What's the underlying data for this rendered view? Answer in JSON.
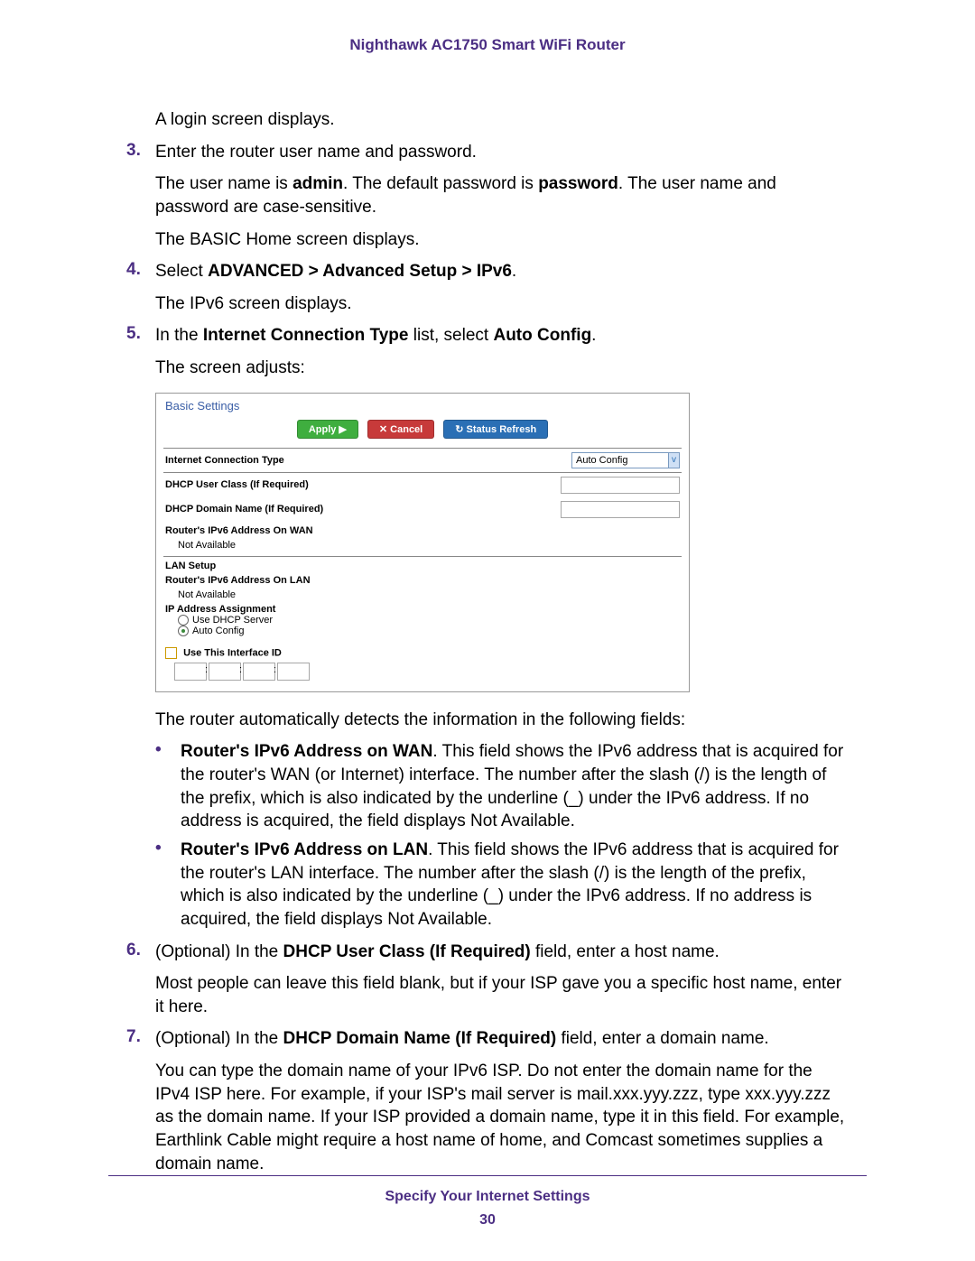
{
  "header": {
    "title": "Nighthawk AC1750 Smart WiFi Router"
  },
  "intro": [
    "A login screen displays."
  ],
  "steps": {
    "s3": {
      "num": "3.",
      "text": "Enter the router user name and password.",
      "after": [
        "The user name is admin. The default password is password. The user name and password are case-sensitive.",
        "The BASIC Home screen displays."
      ],
      "bold": {
        "admin": "admin",
        "password": "password"
      }
    },
    "s4": {
      "num": "4.",
      "text_prefix": "Select ",
      "text_bold": "ADVANCED > Advanced Setup > IPv6",
      "text_suffix": ".",
      "after": [
        "The IPv6 screen displays."
      ]
    },
    "s5": {
      "num": "5.",
      "text_prefix": "In the ",
      "bold1": "Internet Connection Type",
      "mid": " list, select ",
      "bold2": "Auto Config",
      "suffix": ".",
      "after_caption": "The screen adjusts:",
      "after_figure": "The router automatically detects the information in the following fields:",
      "bullets": [
        {
          "bold": "Router's IPv6 Address on WAN",
          "text": ". This field shows the IPv6 address that is acquired for the router's WAN (or Internet) interface. The number after the slash (/) is the length of the prefix, which is also indicated by the underline (_) under the IPv6 address. If no address is acquired, the field displays Not Available."
        },
        {
          "bold": "Router's IPv6 Address on LAN",
          "text": ". This field shows the IPv6 address that is acquired for the router's LAN interface. The number after the slash (/) is the length of the prefix, which is also indicated by the underline (_) under the IPv6 address. If no address is acquired, the field displays Not Available."
        }
      ]
    },
    "s6": {
      "num": "6.",
      "prefix": "(Optional) In the ",
      "bold": "DHCP User Class (If Required)",
      "suffix": " field, enter a host name.",
      "after": [
        "Most people can leave this field blank, but if your ISP gave you a specific host name, enter it here."
      ]
    },
    "s7": {
      "num": "7.",
      "prefix": "(Optional) In the ",
      "bold": "DHCP Domain Name (If Required)",
      "suffix": " field, enter a domain name.",
      "after": [
        "You can type the domain name of your IPv6 ISP. Do not enter the domain name for the IPv4 ISP here. For example, if your ISP's mail server is mail.xxx.yyy.zzz, type xxx.yyy.zzz as the domain name. If your ISP provided a domain name, type it in this field. For example, Earthlink Cable might require a host name of home, and Comcast sometimes supplies a domain name."
      ]
    }
  },
  "figure": {
    "title": "Basic Settings",
    "buttons": {
      "apply": "Apply ▶",
      "cancel": "✕ Cancel",
      "refresh": "↻ Status Refresh"
    },
    "ict_label": "Internet Connection Type",
    "ict_value": "Auto Config",
    "dhcp_user_class": "DHCP User Class  (If Required)",
    "dhcp_domain": "DHCP Domain Name  (If Required)",
    "wan_addr": "Router's IPv6 Address On WAN",
    "not_avail": "Not Available",
    "lan_setup": "LAN Setup",
    "lan_addr": "Router's IPv6 Address On LAN",
    "ip_assign": "IP Address Assignment",
    "radio1": "Use DHCP Server",
    "radio2": "Auto Config",
    "iface_chk": "Use This Interface ID"
  },
  "footer": {
    "section": "Specify Your Internet Settings",
    "page": "30"
  }
}
